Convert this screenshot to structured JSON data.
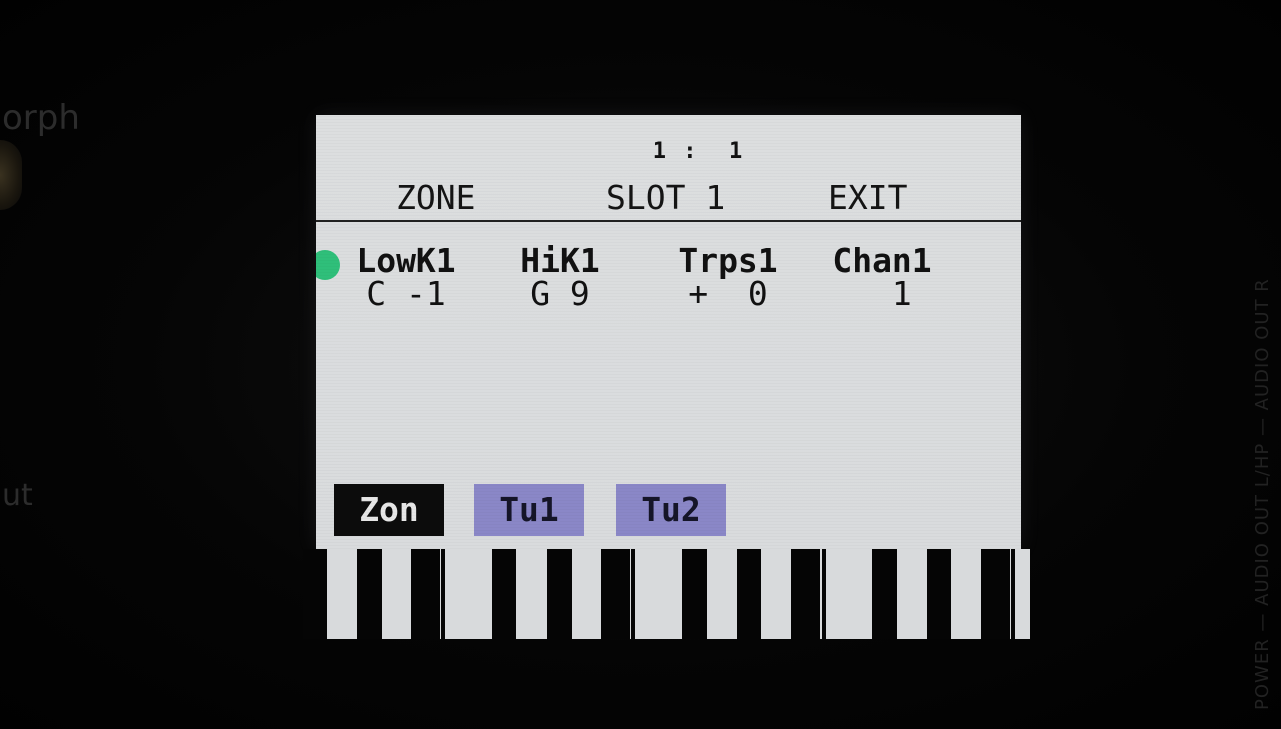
{
  "bezel": {
    "left_top_text": "orph",
    "left_bottom_text": "ut",
    "right_text": "POWER — AUDIO OUT L/HP — AUDIO OUT R"
  },
  "lcd": {
    "position_readout": "1 :  1",
    "top_buttons": {
      "zone": "ZONE",
      "slot": "SLOT 1",
      "exit": "EXIT"
    },
    "params": {
      "lowk": {
        "name": "LowK1",
        "value": "C -1"
      },
      "hik": {
        "name": "HiK1",
        "value": "G 9"
      },
      "trps": {
        "name": "Trps1",
        "value": "+  0"
      },
      "chan": {
        "name": "Chan1",
        "value": "  1"
      }
    },
    "tabs": {
      "zon": "Zon",
      "tu1": "Tu1",
      "tu2": "Tu2"
    },
    "colors": {
      "cursor": "#2fbf7a",
      "selected_tab": "#0c0c0c",
      "inactive_tab": "#8a87c7",
      "screen": "#dcdedf"
    }
  }
}
